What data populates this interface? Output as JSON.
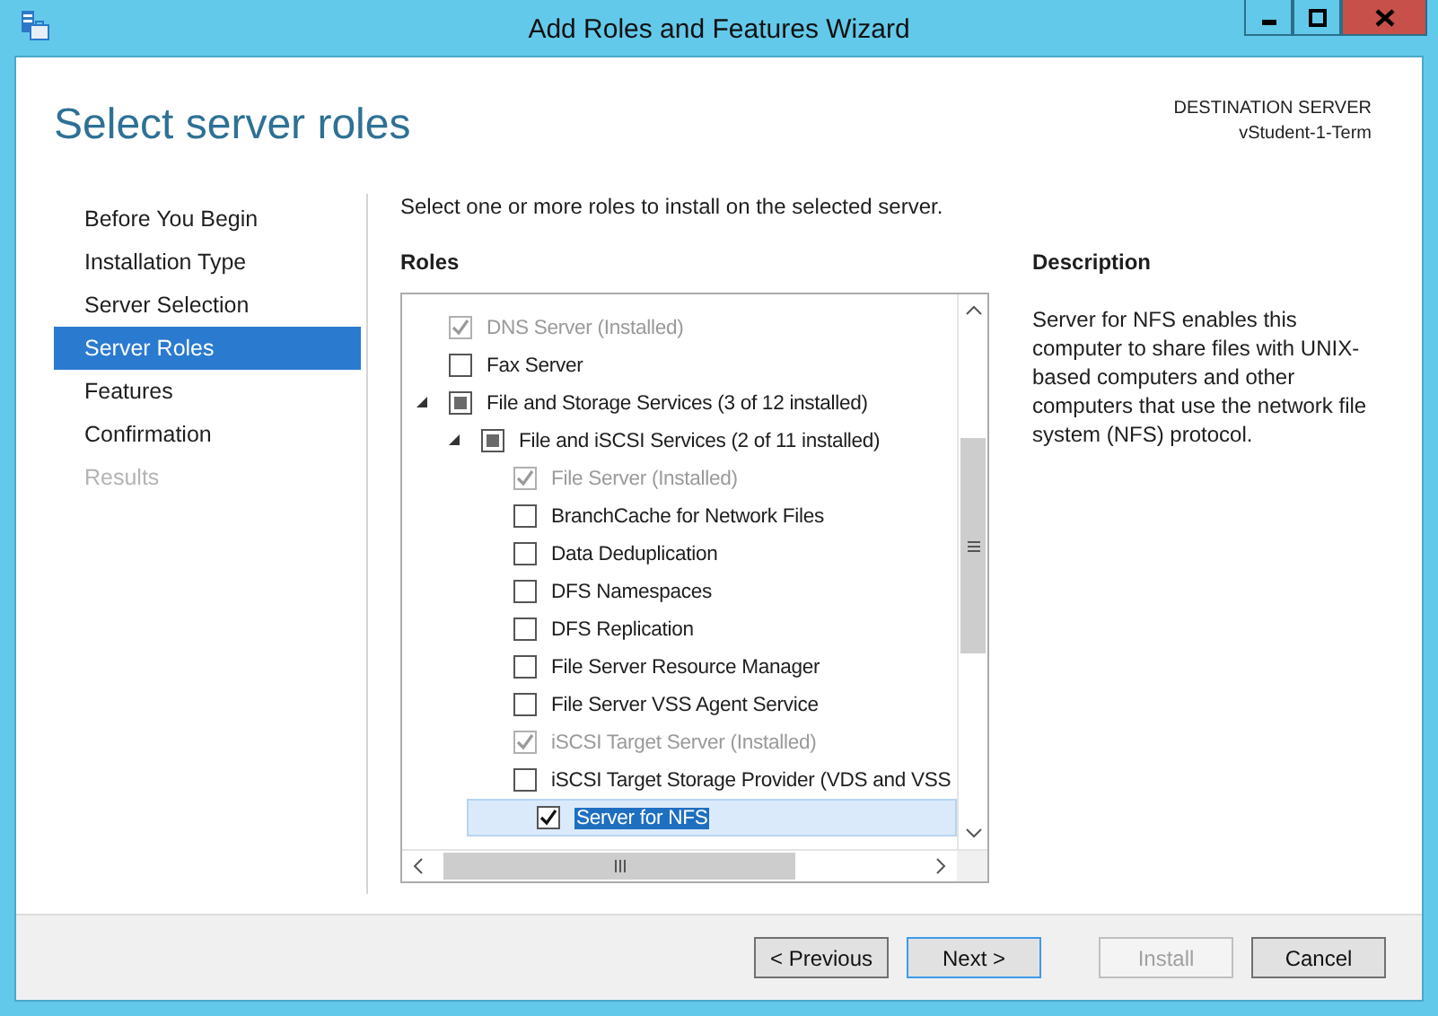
{
  "window": {
    "title": "Add Roles and Features Wizard"
  },
  "page_title": "Select server roles",
  "destination": {
    "label": "DESTINATION SERVER",
    "server": "vStudent-1-Term"
  },
  "steps": [
    {
      "label": "Before You Begin",
      "selected": false,
      "disabled": false
    },
    {
      "label": "Installation Type",
      "selected": false,
      "disabled": false
    },
    {
      "label": "Server Selection",
      "selected": false,
      "disabled": false
    },
    {
      "label": "Server Roles",
      "selected": true,
      "disabled": false
    },
    {
      "label": "Features",
      "selected": false,
      "disabled": false
    },
    {
      "label": "Confirmation",
      "selected": false,
      "disabled": false
    },
    {
      "label": "Results",
      "selected": false,
      "disabled": true
    }
  ],
  "instruction": "Select one or more roles to install on the selected server.",
  "roles_heading": "Roles",
  "roles": [
    {
      "label": "DNS Server (Installed)",
      "checked": true,
      "partial": false,
      "disabled": true,
      "selected": false
    },
    {
      "label": "Fax Server",
      "checked": false,
      "partial": false,
      "disabled": false,
      "selected": false
    },
    {
      "label": "File and Storage Services (3 of 12 installed)",
      "checked": false,
      "partial": true,
      "disabled": false,
      "selected": false,
      "expanded": true,
      "children": [
        {
          "label": "File and iSCSI Services (2 of 11 installed)",
          "checked": false,
          "partial": true,
          "disabled": false,
          "selected": false,
          "expanded": true,
          "children": [
            {
              "label": "File Server (Installed)",
              "checked": true,
              "partial": false,
              "disabled": true,
              "selected": false
            },
            {
              "label": "BranchCache for Network Files",
              "checked": false,
              "partial": false,
              "disabled": false,
              "selected": false
            },
            {
              "label": "Data Deduplication",
              "checked": false,
              "partial": false,
              "disabled": false,
              "selected": false
            },
            {
              "label": "DFS Namespaces",
              "checked": false,
              "partial": false,
              "disabled": false,
              "selected": false
            },
            {
              "label": "DFS Replication",
              "checked": false,
              "partial": false,
              "disabled": false,
              "selected": false
            },
            {
              "label": "File Server Resource Manager",
              "checked": false,
              "partial": false,
              "disabled": false,
              "selected": false
            },
            {
              "label": "File Server VSS Agent Service",
              "checked": false,
              "partial": false,
              "disabled": false,
              "selected": false
            },
            {
              "label": "iSCSI Target Server (Installed)",
              "checked": true,
              "partial": false,
              "disabled": true,
              "selected": false
            },
            {
              "label": "iSCSI Target Storage Provider (VDS and VSS",
              "checked": false,
              "partial": false,
              "disabled": false,
              "selected": false
            },
            {
              "label": "Server for NFS",
              "checked": true,
              "partial": false,
              "disabled": false,
              "selected": true
            }
          ]
        }
      ]
    }
  ],
  "description": {
    "heading": "Description",
    "text": "Server for NFS enables this computer to share files with UNIX-based computers and other computers that use the network file system (NFS) protocol."
  },
  "buttons": [
    {
      "label": "< Previous",
      "disabled": false,
      "focused": false
    },
    {
      "label": "Next >",
      "disabled": false,
      "focused": true
    },
    {
      "label": "Install",
      "disabled": true,
      "focused": false
    },
    {
      "label": "Cancel",
      "disabled": false,
      "focused": false
    }
  ]
}
